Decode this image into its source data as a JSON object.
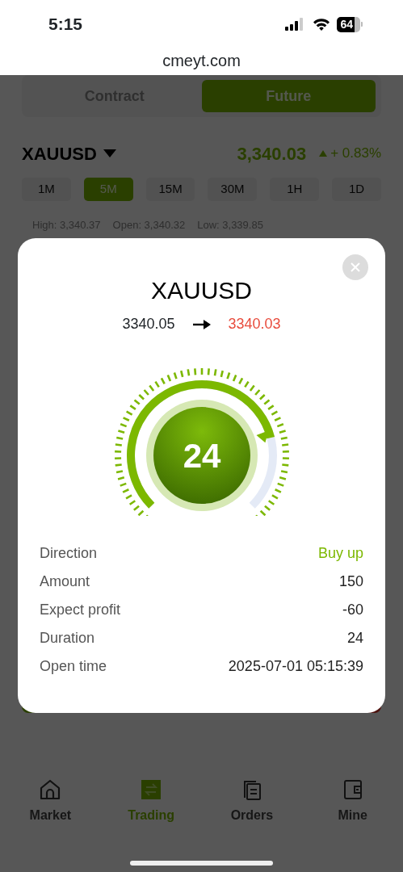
{
  "status_bar": {
    "time": "5:15",
    "battery": "64"
  },
  "browser": {
    "url": "cmeyt.com"
  },
  "mode_tabs": [
    {
      "label": "Contract",
      "selected": false
    },
    {
      "label": "Future",
      "selected": true
    }
  ],
  "instrument": {
    "symbol": "XAUUSD",
    "price": "3,340.03",
    "change": "+ 0.83%",
    "rising": true
  },
  "intervals": [
    {
      "label": "1M",
      "selected": false
    },
    {
      "label": "5M",
      "selected": true
    },
    {
      "label": "15M",
      "selected": false
    },
    {
      "label": "30M",
      "selected": false
    },
    {
      "label": "1H",
      "selected": false
    },
    {
      "label": "1D",
      "selected": false
    }
  ],
  "stats": [
    "High: 3,340.37",
    "Open: 3,340.32",
    "Low: 3,339.85"
  ],
  "action_buttons": [
    {
      "kind": "buy"
    },
    {
      "kind": "sell"
    }
  ],
  "order_dialog": {
    "title": "XAUUSD",
    "open_price": "3340.05",
    "current_price": "3340.03",
    "price_rising": false,
    "timer": {
      "value": "24"
    },
    "details": [
      {
        "label": "Direction",
        "value": "Buy up",
        "kind": "direction"
      },
      {
        "label": "Amount",
        "value": "150",
        "kind": "plain"
      },
      {
        "label": "Expect profit",
        "value": "-60",
        "kind": "plain"
      },
      {
        "label": "Duration",
        "value": "24",
        "kind": "plain"
      },
      {
        "label": "Open time",
        "value": "2025-07-01 05:15:39",
        "kind": "plain"
      }
    ]
  },
  "nav": [
    {
      "label": "Market",
      "kind": "home",
      "selected": false
    },
    {
      "label": "Trading",
      "kind": "swap",
      "selected": true
    },
    {
      "label": "Orders",
      "kind": "orders",
      "selected": false
    },
    {
      "label": "Mine",
      "kind": "wallet",
      "selected": false
    }
  ]
}
